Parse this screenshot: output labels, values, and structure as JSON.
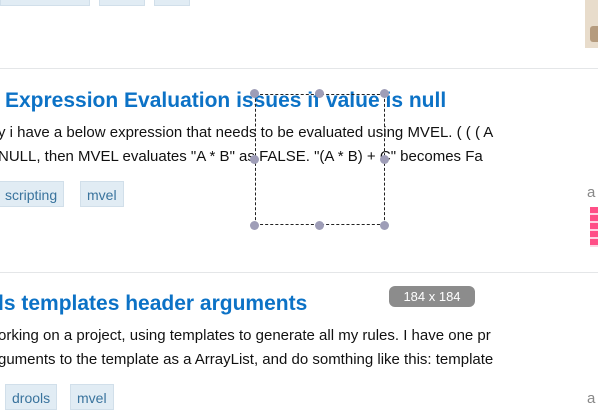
{
  "questions": [
    {
      "title": "Expression Evaluation issues if value is null",
      "excerpt_line1": "y i have a below expression that needs to be evaluated using MVEL. ( ( ( A",
      "excerpt_line2": "NULL, then MVEL evaluates \"A * B\" as FALSE. \"(A * B) + C\" becomes Fa",
      "tags": [
        "scripting",
        "mvel"
      ],
      "side_letter": "a"
    },
    {
      "title": "ls templates header arguments",
      "excerpt_line1": "orking on a project, using templates to generate all my rules. I have one pr",
      "excerpt_line2": "guments to the template as a ArrayList, and do somthing like this: template",
      "tags": [
        "drools",
        "mvel"
      ],
      "side_letter": "a"
    }
  ],
  "selection": {
    "size_label": "184 x 184",
    "handle_color": "#9e9db7"
  },
  "colors": {
    "title": "#0c72c6",
    "tag_bg": "#e1ecf4",
    "tag_text": "#39739d",
    "badge_bg": "#8c8c8c",
    "identicon": "#f08",
    "divider": "#e4e6e8"
  }
}
